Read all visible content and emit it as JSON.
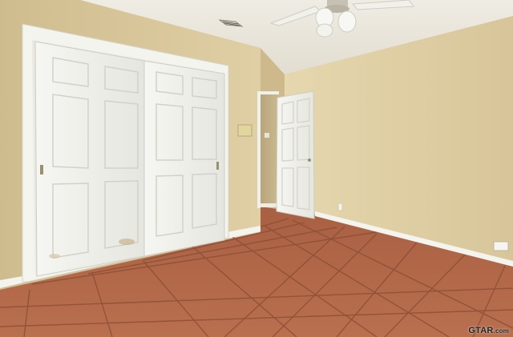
{
  "watermark": {
    "brand": "GTAR",
    "suffix": ".com"
  },
  "colors": {
    "wall_left": "#dcca9e",
    "wall_right": "#dfcfa6",
    "ceiling": "#ebe7dc",
    "floor_tile": "#b76a4a",
    "grout": "#8f5238",
    "door_white": "#f2f2ee",
    "baseboard": "#f5f5f1"
  }
}
